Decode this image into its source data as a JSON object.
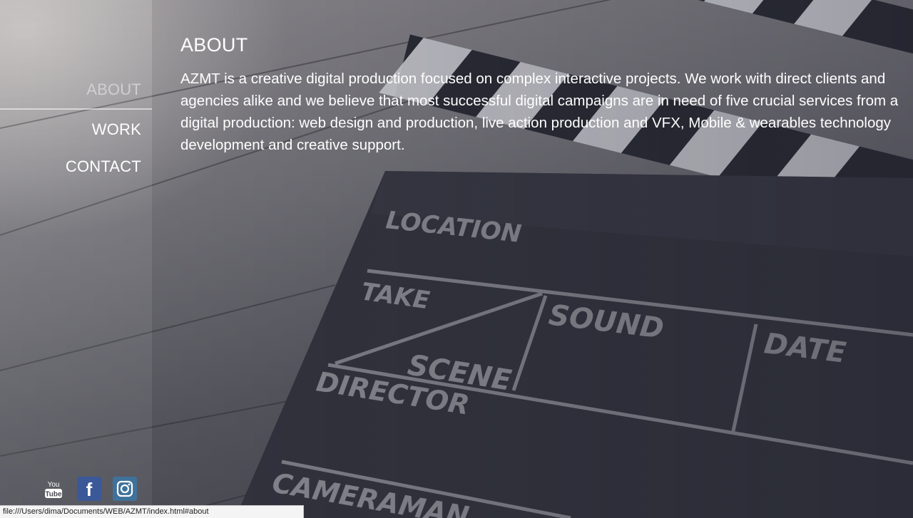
{
  "nav": {
    "items": [
      {
        "label": "ABOUT",
        "active": true
      },
      {
        "label": "WORK",
        "active": false
      },
      {
        "label": "CONTACT",
        "active": false
      }
    ]
  },
  "about": {
    "title": "ABOUT",
    "text": "AZMT is a creative digital production focused on complex interactive projects. We work with direct clients and agencies alike and we believe that most successful digital campaigns are in need of five crucial services from a digital production: web design and production, live action production and VFX, Mobile & wearables technology development and creative support."
  },
  "background": {
    "clapperboard_labels": [
      "LOCATION",
      "TAKE",
      "SCENE",
      "SOUND",
      "DATE",
      "DIRECTOR",
      "CAMERAMAN"
    ]
  },
  "social": {
    "icons": [
      "youtube-icon",
      "facebook-icon",
      "instagram-icon"
    ],
    "youtube_text": [
      "You",
      "Tube"
    ],
    "facebook_glyph": "f"
  },
  "status": {
    "url": "file:///Users/dima/Documents/WEB/AZMT/index.html#about"
  },
  "colors": {
    "facebook": "#3b5998",
    "instagram": "#3f729b",
    "text": "#ffffff",
    "active_nav": "#cfcfd3"
  }
}
